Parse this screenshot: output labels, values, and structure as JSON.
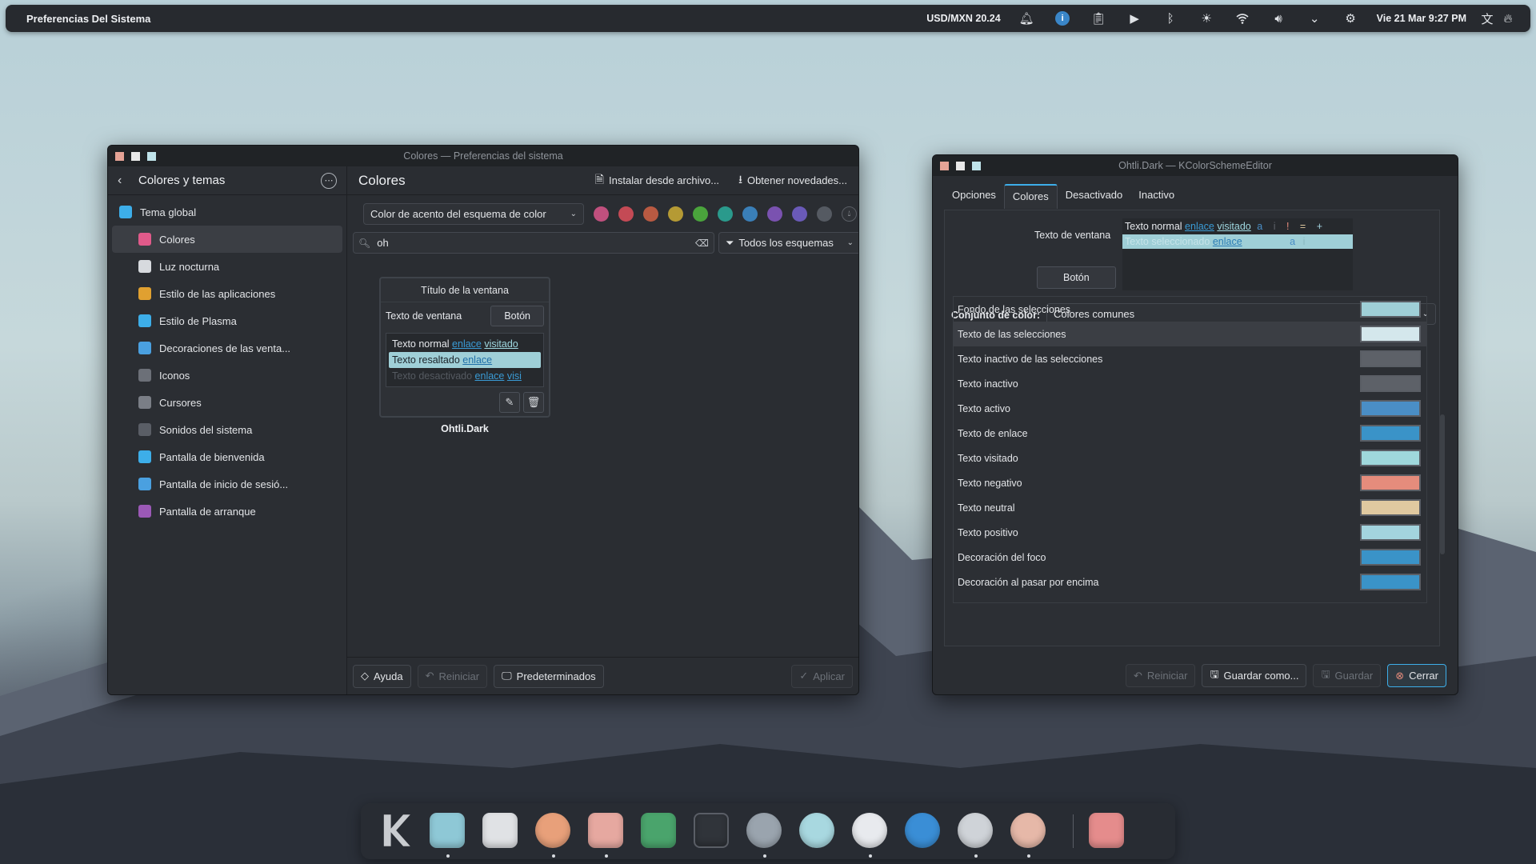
{
  "topbar": {
    "app_title": "Preferencias Del Sistema",
    "currency": "USD/MXN 20.24",
    "datetime": "Vie 21 Mar  9:27 PM",
    "tray_icons": [
      "bell-icon",
      "info-icon",
      "clipboard-icon",
      "media-play-icon",
      "bluetooth-icon",
      "brightness-icon",
      "wifi-icon",
      "volume-icon",
      "chevron-down-icon",
      "update-icon",
      "translate-icon",
      "flame-icon"
    ]
  },
  "settings": {
    "window_title": "Colores — Preferencias del sistema",
    "sidebar": {
      "back_title": "Colores y temas",
      "items": [
        {
          "label": "Tema global",
          "icon": "global-theme-icon",
          "color": "#3daee9"
        },
        {
          "label": "Colores",
          "icon": "colors-icon",
          "color": "#e05a8a"
        },
        {
          "label": "Luz nocturna",
          "icon": "night-light-icon",
          "color": "#d7dade"
        },
        {
          "label": "Estilo de las aplicaciones",
          "icon": "app-style-icon",
          "color": "#e0a030"
        },
        {
          "label": "Estilo de Plasma",
          "icon": "plasma-style-icon",
          "color": "#3daee9"
        },
        {
          "label": "Decoraciones de las venta...",
          "icon": "window-decorations-icon",
          "color": "#4aa0e0"
        },
        {
          "label": "Iconos",
          "icon": "icons-icon",
          "color": "#6c7078"
        },
        {
          "label": "Cursores",
          "icon": "cursors-icon",
          "color": "#7a7e86"
        },
        {
          "label": "Sonidos del sistema",
          "icon": "sounds-icon",
          "color": "#5a5e66"
        },
        {
          "label": "Pantalla de bienvenida",
          "icon": "splash-icon",
          "color": "#3daee9"
        },
        {
          "label": "Pantalla de inicio de sesió...",
          "icon": "login-screen-icon",
          "color": "#4aa0e0"
        },
        {
          "label": "Pantalla de arranque",
          "icon": "boot-screen-icon",
          "color": "#9b59b6"
        }
      ]
    },
    "header": {
      "title": "Colores",
      "install_label": "Instalar desde archivo...",
      "get_new_label": "Obtener novedades..."
    },
    "accent": {
      "combo_label": "Color de acento del esquema de color",
      "swatches": [
        "#c0507e",
        "#c44a55",
        "#b95a42",
        "#b59a34",
        "#4aa43c",
        "#2a9a8c",
        "#3a7fb8",
        "#7a52b0",
        "#6a5ab8",
        "#555a62"
      ]
    },
    "search": {
      "value": "oh",
      "filter_label": "Todos los esquemas"
    },
    "preview": {
      "window_title": "Título de la ventana",
      "window_text": "Texto de ventana",
      "button": "Botón",
      "normal_text": "Texto normal",
      "link": "enlace",
      "visited": "visitado",
      "highlighted_text": "Texto resaltado",
      "disabled_text": "Texto desactivado",
      "visited_cut": "visi",
      "scheme_name": "Ohtli.Dark"
    },
    "footer": {
      "help": "Ayuda",
      "reset": "Reiniciar",
      "defaults": "Predeterminados",
      "apply": "Aplicar"
    }
  },
  "editor": {
    "window_title": "Ohtli.Dark — KColorSchemeEditor",
    "tabs": [
      "Opciones",
      "Colores",
      "Desactivado",
      "Inactivo"
    ],
    "active_tab": "Colores",
    "preview": {
      "window_text": "Texto de ventana",
      "normal_text": "Texto normal",
      "link": "enlace",
      "visited": "visitado",
      "marks": [
        "a",
        "i",
        "!",
        "=",
        "+"
      ],
      "selected_text": "Texto seleccionado",
      "selected_marks": [
        "a",
        "i"
      ],
      "button": "Botón"
    },
    "color_set_label": "Conjunto de color:",
    "color_set_value": "Colores comunes",
    "rows": [
      {
        "label": "Fondo de las selecciones",
        "color": "#9fcfd7"
      },
      {
        "label": "Texto de las selecciones",
        "color": "#d4e7ec"
      },
      {
        "label": "Texto inactivo de las selecciones",
        "color": "#5d6168"
      },
      {
        "label": "Texto inactivo",
        "color": "#5d6168"
      },
      {
        "label": "Texto activo",
        "color": "#4a8ec6"
      },
      {
        "label": "Texto de enlace",
        "color": "#3a93c8"
      },
      {
        "label": "Texto visitado",
        "color": "#9fd8dc"
      },
      {
        "label": "Texto negativo",
        "color": "#e58c7c"
      },
      {
        "label": "Texto neutral",
        "color": "#e0c9a0"
      },
      {
        "label": "Texto positivo",
        "color": "#a3d4de"
      },
      {
        "label": "Decoración del foco",
        "color": "#3a93c8"
      },
      {
        "label": "Decoración al pasar por encima",
        "color": "#3a93c8"
      }
    ],
    "footer": {
      "reset": "Reiniciar",
      "save_as": "Guardar como...",
      "save": "Guardar",
      "close": "Cerrar"
    }
  },
  "dock": {
    "apps": [
      {
        "name": "kde-icon",
        "color": "#c9ccd0",
        "running": false
      },
      {
        "name": "file-manager-icon",
        "color": "#8ec8d6",
        "running": true
      },
      {
        "name": "software-store-icon",
        "color": "#e0e2e5",
        "running": false
      },
      {
        "name": "duck-browser-icon",
        "color": "#e8a07a",
        "running": true
      },
      {
        "name": "audio-player-icon",
        "color": "#e6a8a0",
        "running": true
      },
      {
        "name": "image-viewer-icon",
        "color": "#4aa46c",
        "running": false
      },
      {
        "name": "terminal-icon",
        "color": "#3a3e44",
        "running": false
      },
      {
        "name": "system-settings-icon",
        "color": "#9aa4ae",
        "running": true
      },
      {
        "name": "spotify-icon",
        "color": "#a8d8e0",
        "running": false
      },
      {
        "name": "inkscape-icon",
        "color": "#e8eaee",
        "running": true
      },
      {
        "name": "edge-browser-icon",
        "color": "#3a8ed6",
        "running": false
      },
      {
        "name": "gaming-icon",
        "color": "#cfd3d8",
        "running": true
      },
      {
        "name": "krita-icon",
        "color": "#e6b8a8",
        "running": true
      },
      {
        "name": "calculator-icon",
        "color": "#e58c8c",
        "running": false
      }
    ]
  }
}
